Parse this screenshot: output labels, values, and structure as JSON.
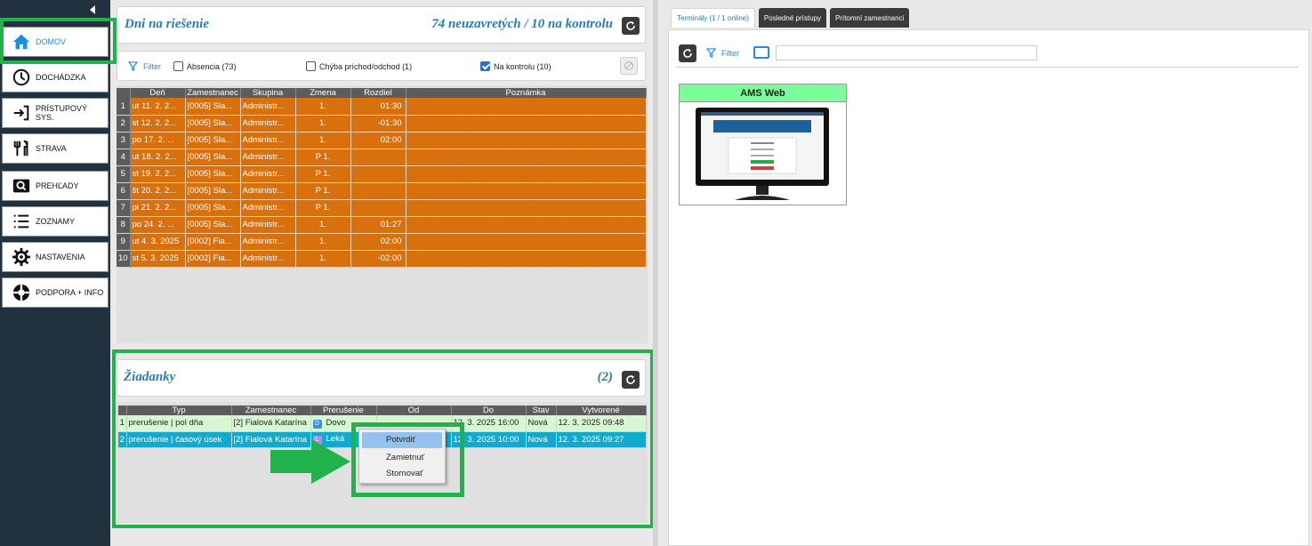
{
  "sidebar": {
    "items": [
      {
        "label": "DOMOV",
        "icon": "home-icon"
      },
      {
        "label": "DOCHÁDZKA",
        "icon": "clock-icon"
      },
      {
        "label": "PRÍSTUPOVÝ SYS.",
        "icon": "login-icon"
      },
      {
        "label": "STRAVA",
        "icon": "cutlery-icon"
      },
      {
        "label": "PREHĽADY",
        "icon": "search-icon"
      },
      {
        "label": "ZOZNAMY",
        "icon": "list-icon"
      },
      {
        "label": "NASTAVENIA",
        "icon": "gear-icon"
      },
      {
        "label": "PODPORA + INFO",
        "icon": "lifebuoy-icon"
      }
    ]
  },
  "days_panel": {
    "title": "Dni na riešenie",
    "summary": "74 neuzavretých / 10 na kontrolu",
    "filter_label": "Filter",
    "checkboxes": [
      {
        "label": "Absencia (73)",
        "checked": false
      },
      {
        "label": "Chýba príchod/odchod (1)",
        "checked": false
      },
      {
        "label": "Na kontrolu (10)",
        "checked": true
      }
    ],
    "columns": [
      "Deň",
      "Zamestnanec",
      "Skupina",
      "Zmena",
      "Rozdiel",
      "Poznámka"
    ],
    "rows": [
      [
        "1",
        "ut 11. 2. 2...",
        "[0005] Sla...",
        "Administr...",
        "1.",
        "01:30",
        ""
      ],
      [
        "2",
        "st 12. 2. 2...",
        "[0005] Sla...",
        "Administr...",
        "1.",
        "-01:30",
        ""
      ],
      [
        "3",
        "po 17. 2. ...",
        "[0005] Sla...",
        "Administr...",
        "1.",
        "02:00",
        ""
      ],
      [
        "4",
        "ut 18. 2. 2...",
        "[0005] Sla...",
        "Administr...",
        "P 1.",
        "",
        ""
      ],
      [
        "5",
        "st 19. 2. 2...",
        "[0005] Sla...",
        "Administr...",
        "P 1.",
        "",
        ""
      ],
      [
        "6",
        "št 20. 2. 2...",
        "[0005] Sla...",
        "Administr...",
        "P 1.",
        "",
        ""
      ],
      [
        "7",
        "pi 21. 2. 2...",
        "[0005] Sla...",
        "Administr...",
        "P 1.",
        "",
        ""
      ],
      [
        "8",
        "po 24. 2. ...",
        "[0005] Sla...",
        "Administr...",
        "1.",
        "01:27",
        ""
      ],
      [
        "9",
        "ut 4. 3. 2025",
        "[0002] Fia...",
        "Administr...",
        "1.",
        "02:00",
        ""
      ],
      [
        "10",
        "st 5. 3. 2025",
        "[0002] Fia...",
        "Administr...",
        "1.",
        "-02:00",
        ""
      ]
    ]
  },
  "requests_panel": {
    "title": "Žiadanky",
    "count": "(2)",
    "columns": [
      "Typ",
      "Zamestnanec",
      "Prerušenie",
      "Od",
      "Do",
      "Stav",
      "Vytvorené"
    ],
    "rows": [
      {
        "n": "1",
        "typ": "prerušenie | pol dňa",
        "zam": "[2] Fialová Katarína",
        "badge": "D",
        "prer": "Dovo",
        "od": "",
        "do": "12. 3. 2025 16:00",
        "stav": "Nová",
        "vytv": "12. 3. 2025  09:48"
      },
      {
        "n": "2",
        "typ": "prerušenie | časový úsek",
        "zam": "[2] Fialová Katarína",
        "badge": "L",
        "prer": "Leká",
        "od": "",
        "do": "12. 3. 2025 10:00",
        "stav": "Nová",
        "vytv": "12. 3. 2025  09:27"
      }
    ],
    "context_menu": [
      "Potvrdiť",
      "Zamietnuť",
      "Stornovať"
    ]
  },
  "right_panel": {
    "tabs": [
      "Terminály (1 / 1 online)",
      "Posledné prístupy",
      "Prítomní zamestnanci"
    ],
    "filter_label": "Filter",
    "terminal_name": "AMS Web"
  },
  "colors": {
    "highlight": "#22b24c",
    "row_orange": "#d9700e",
    "selected_row": "#12a9cf",
    "accent_blue": "#2b7bb0"
  }
}
